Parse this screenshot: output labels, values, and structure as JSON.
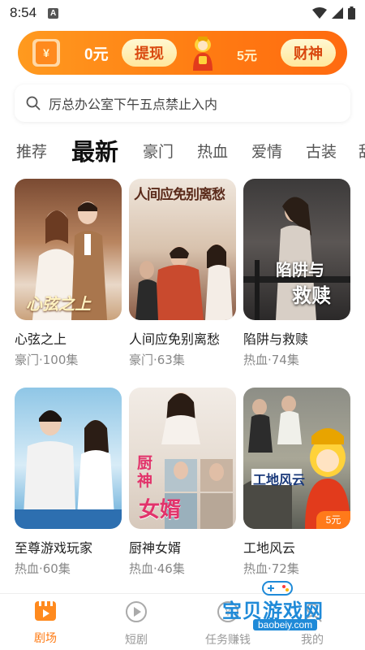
{
  "status_bar": {
    "time": "8:54",
    "indicator": "A"
  },
  "banner": {
    "cash_amount": "0元",
    "withdraw_label": "提现",
    "reward_amount": "5元",
    "caishen_label": "财神",
    "redpack_icon_text": "¥"
  },
  "search": {
    "placeholder": "厉总办公室下午五点禁止入内"
  },
  "tabs": [
    "推荐",
    "最新",
    "豪门",
    "热血",
    "爱情",
    "古装",
    "甜"
  ],
  "active_tab": "最新",
  "cards": [
    {
      "title": "心弦之上",
      "meta": "豪门·100集",
      "poster_text": "心弦之上"
    },
    {
      "title": "人间应免别离愁",
      "meta": "豪门·63集",
      "poster_text": "人间应免别离愁"
    },
    {
      "title": "陷阱与救赎",
      "meta": "热血·74集",
      "poster_text_line1": "陷阱与",
      "poster_text_line2": "救赎"
    },
    {
      "title": "至尊游戏玩家",
      "meta": "热血·60集"
    },
    {
      "title": "厨神女婿",
      "meta": "热血·46集",
      "poster_text_line1": "厨神",
      "poster_text_line2": "女婿"
    },
    {
      "title": "工地风云",
      "meta": "热血·72集",
      "poster_text": "工地风云",
      "reward_badge": "5元"
    }
  ],
  "bottom_nav": [
    {
      "label": "剧场",
      "icon": "film-icon",
      "active": true
    },
    {
      "label": "短剧",
      "icon": "play-circle-icon",
      "active": false
    },
    {
      "label": "任务赚钱",
      "icon": "coin-icon",
      "active": false
    },
    {
      "label": "我的",
      "icon": "user-icon",
      "active": false
    }
  ],
  "watermark": {
    "text": "宝贝游戏网",
    "url": "baobeiy.com"
  },
  "colors": {
    "accent": "#ff7a12",
    "banner_text": "#d9480f",
    "watermark": "#1f8ad8"
  }
}
